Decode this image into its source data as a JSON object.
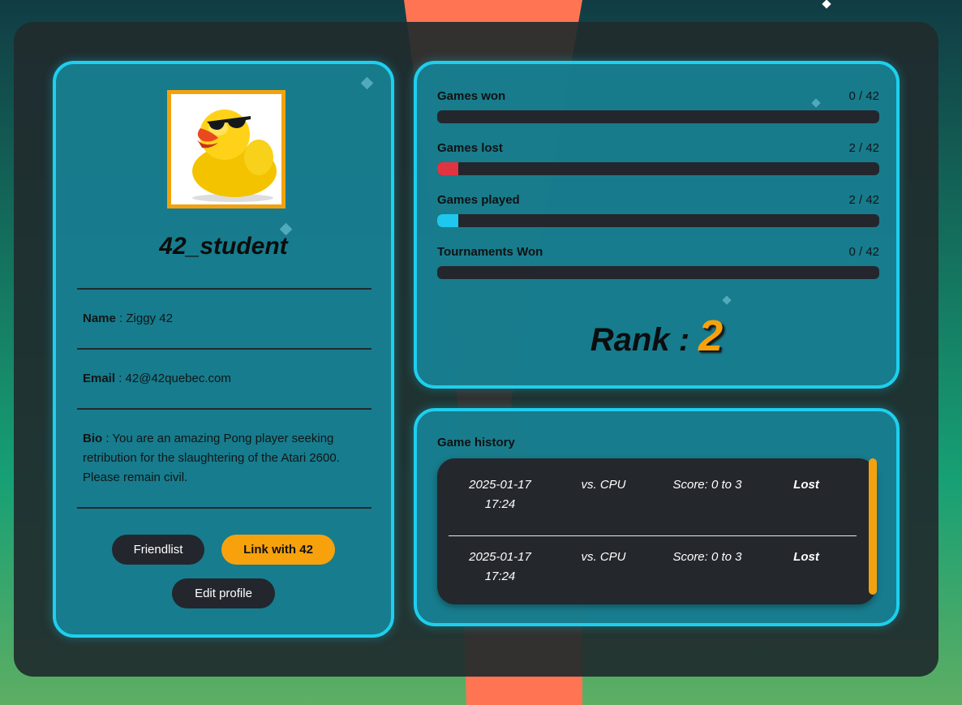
{
  "profile": {
    "username": "42_student",
    "name_label": "Name",
    "name_value": "Ziggy 42",
    "email_label": "Email",
    "email_value": "42@42quebec.com",
    "bio_label": "Bio",
    "bio_value": "You are an amazing Pong player seeking retribution for the slaughtering of the Atari 2600. Please remain civil.",
    "buttons": {
      "friendlist": "Friendlist",
      "link42": "Link with 42",
      "edit": "Edit profile"
    },
    "avatar_icon": "rubber-duck-sunglasses"
  },
  "stats": {
    "items": [
      {
        "label": "Games won",
        "value": "0 / 42",
        "progress": 0,
        "color": "#23272d"
      },
      {
        "label": "Games lost",
        "value": "2 / 42",
        "progress": 0.0476,
        "color": "#e03443"
      },
      {
        "label": "Games played",
        "value": "2 / 42",
        "progress": 0.0476,
        "color": "#1ec7ee"
      },
      {
        "label": "Tournaments Won",
        "value": "0 / 42",
        "progress": 0,
        "color": "#23272d"
      }
    ],
    "rank_label": "Rank :",
    "rank_value": "2"
  },
  "history": {
    "title": "Game history",
    "matches": [
      {
        "date": "2025-01-17",
        "time": "17:24",
        "opponent": "vs. CPU",
        "score": "Score: 0 to 3",
        "result": "Lost"
      },
      {
        "date": "2025-01-17",
        "time": "17:24",
        "opponent": "vs. CPU",
        "score": "Score: 0 to 3",
        "result": "Lost"
      }
    ]
  },
  "colors": {
    "accent": "#1ecfee",
    "gold": "#f7a20c",
    "dark": "#23272d",
    "panel": "#178295"
  }
}
